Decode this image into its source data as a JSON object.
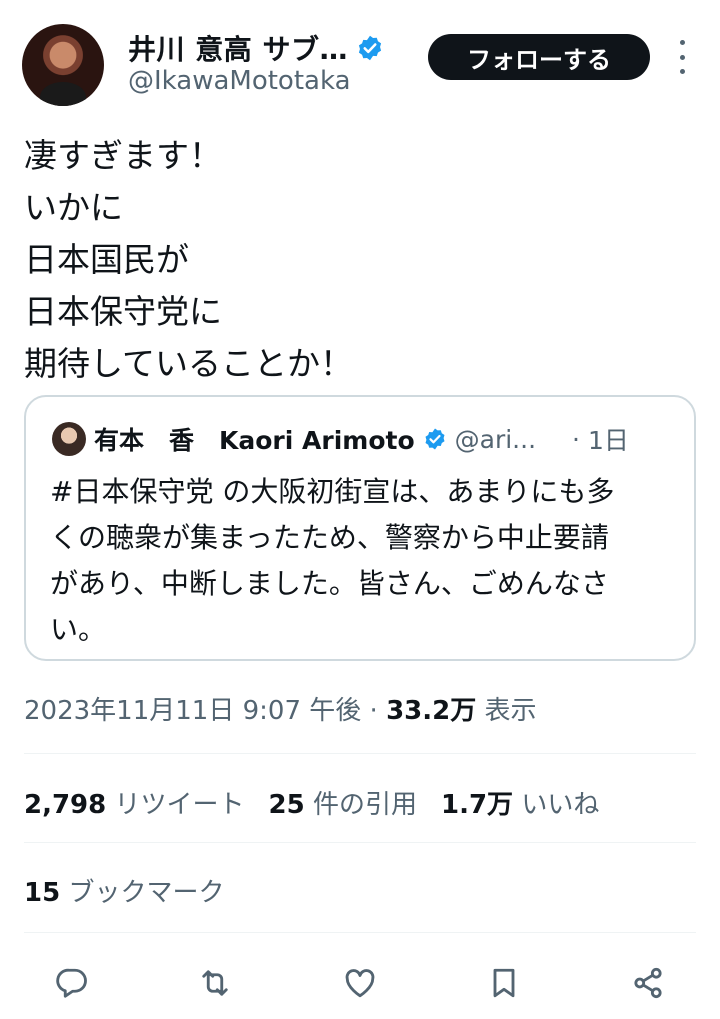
{
  "author": {
    "display_name": "井川 意高 サブ…",
    "handle": "@IkawaMototaka"
  },
  "follow_label": "フォローする",
  "tweet_lines": [
    "凄すぎます！",
    "いかに",
    "日本国民が",
    "日本保守党に",
    "期待していることか！"
  ],
  "quote": {
    "name": "有本　香　Kaori Arimoto",
    "handle": "@ari...",
    "dot": "·",
    "time": "1日",
    "lines": [
      "#日本保守党 の大阪初街宣は、あまりにも多",
      "くの聴衆が集まったため、警察から中止要請",
      "があり、中断しました。皆さん、ごめんなさ",
      "い。"
    ]
  },
  "meta": {
    "timestamp": "2023年11月11日 9:07 午後",
    "separator": "·",
    "views": "33.2万",
    "views_label": "表示"
  },
  "stats": {
    "retweets": "2,798",
    "retweets_label": "リツイート",
    "quotes": "25",
    "quotes_label": "件の引用",
    "likes": "1.7万",
    "likes_label": "いいね"
  },
  "bookmarks": {
    "count": "15",
    "label": "ブックマーク"
  },
  "colors": {
    "text": "#0f1419",
    "secondary": "#536471",
    "verified": "#1d9bf0",
    "border": "#cfd9de"
  },
  "icons": [
    "reply-icon",
    "retweet-icon",
    "like-icon",
    "bookmark-icon",
    "share-icon"
  ]
}
